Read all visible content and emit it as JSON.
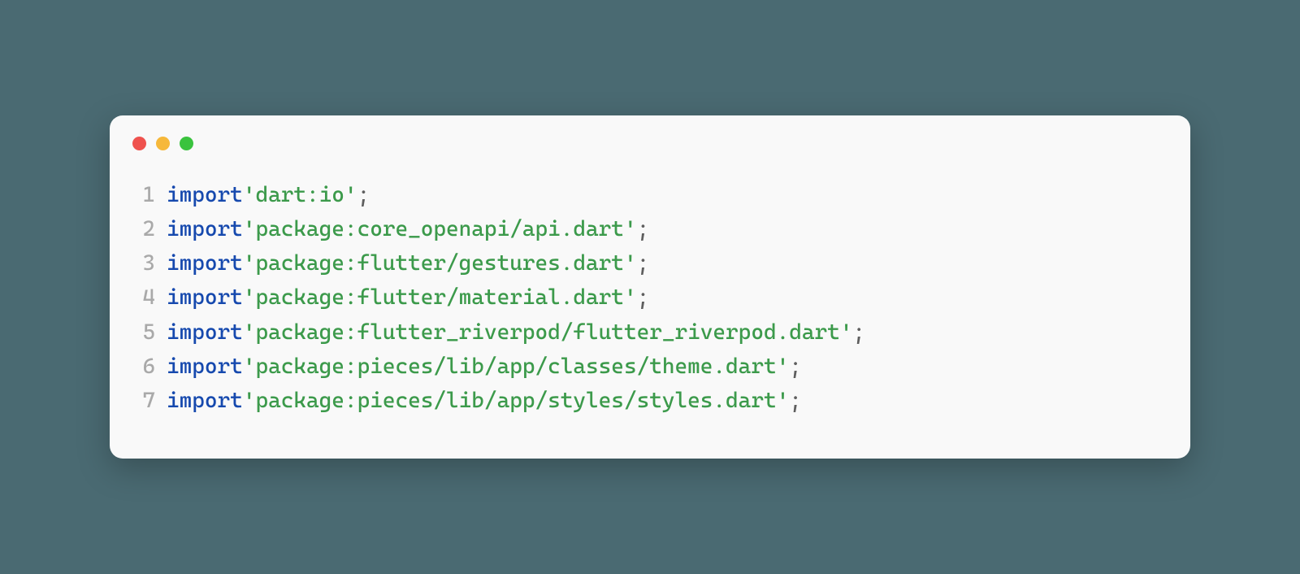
{
  "window": {
    "traffic_lights": [
      "close",
      "minimize",
      "zoom"
    ],
    "colors": {
      "bg_page": "#4a6a72",
      "bg_window": "#f9f9f9",
      "keyword": "#1649ae",
      "string": "#3c9a4b",
      "punctuation": "#5e5e5e",
      "line_number": "#a9a9a9",
      "dot_red": "#ef524e",
      "dot_yellow": "#f6b83a",
      "dot_green": "#3ac33e"
    }
  },
  "code": {
    "language": "dart",
    "lines": [
      {
        "n": "1",
        "keyword": "import",
        "string": "'dart:io'",
        "end": ";"
      },
      {
        "n": "2",
        "keyword": "import",
        "string": "'package:core_openapi/api.dart'",
        "end": ";"
      },
      {
        "n": "3",
        "keyword": "import",
        "string": "'package:flutter/gestures.dart'",
        "end": ";"
      },
      {
        "n": "4",
        "keyword": "import",
        "string": "'package:flutter/material.dart'",
        "end": ";"
      },
      {
        "n": "5",
        "keyword": "import",
        "string": "'package:flutter_riverpod/flutter_riverpod.dart'",
        "end": ";"
      },
      {
        "n": "6",
        "keyword": "import",
        "string": "'package:pieces/lib/app/classes/theme.dart'",
        "end": ";"
      },
      {
        "n": "7",
        "keyword": "import",
        "string": "'package:pieces/lib/app/styles/styles.dart'",
        "end": ";"
      }
    ]
  }
}
